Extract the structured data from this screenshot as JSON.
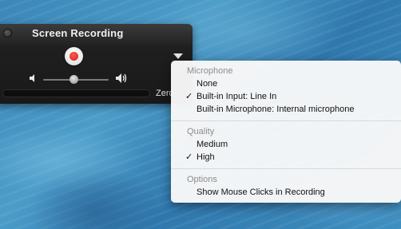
{
  "recorder": {
    "title": "Screen Recording",
    "file_size": "Zero"
  },
  "menu": {
    "microphone_header": "Microphone",
    "microphone_options": [
      "None",
      "Built-in Input: Line In",
      "Built-in Microphone: Internal microphone"
    ],
    "microphone_selected": "Built-in Input: Line In",
    "quality_header": "Quality",
    "quality_options": [
      "Medium",
      "High"
    ],
    "quality_selected": "High",
    "options_header": "Options",
    "options_items": [
      "Show Mouse Clicks in Recording"
    ],
    "checkmark": "✓"
  },
  "colors": {
    "record_red": "#e0261c",
    "panel_dark": "#1c1c1c",
    "menu_bg": "#f8f8f8"
  },
  "icons": {
    "close": "close-icon",
    "record": "record-icon",
    "dropdown": "triangle-down-icon",
    "volume_low": "speaker-low-icon",
    "volume_high": "speaker-high-icon"
  },
  "volume_level": 0.47
}
